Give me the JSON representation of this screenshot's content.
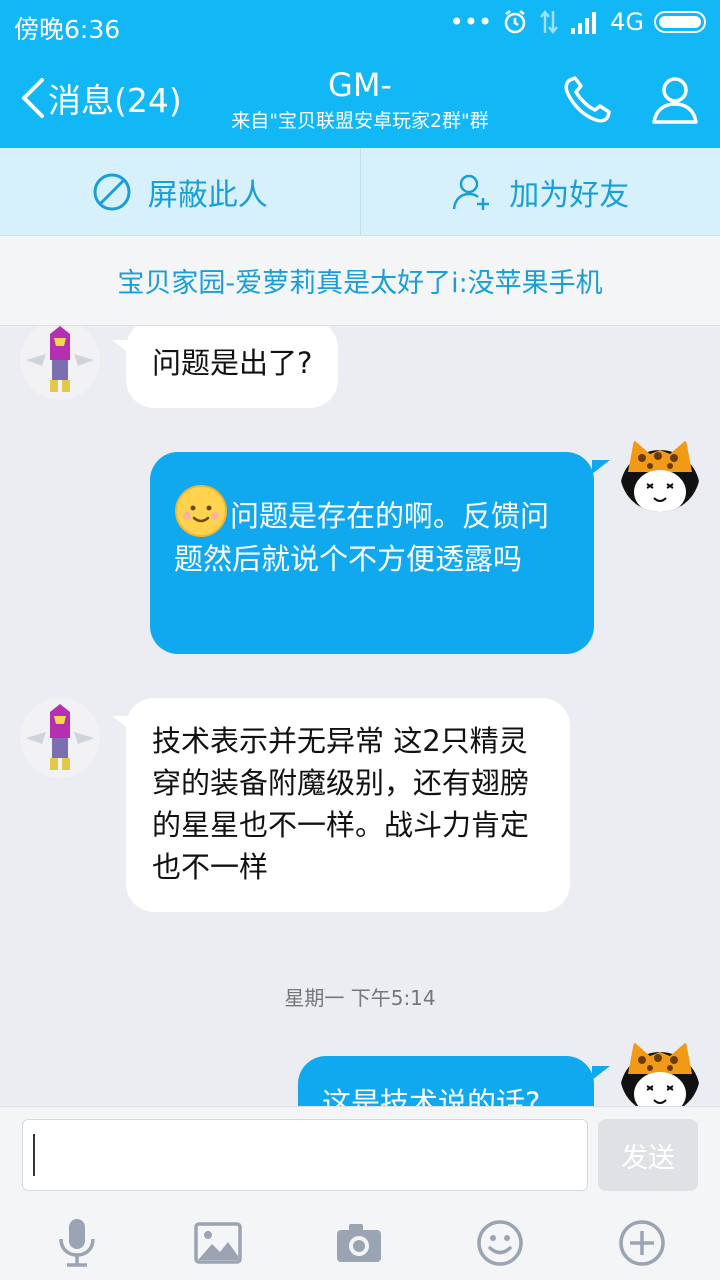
{
  "status_bar": {
    "time": "傍晚6:36",
    "dots": "•••",
    "network": "4G"
  },
  "nav": {
    "back_label": "消息(24)",
    "title": "GM-",
    "subtitle": "来自\"宝贝联盟安卓玩家2群\"群"
  },
  "actions": {
    "block_label": "屏蔽此人",
    "add_friend_label": "加为好友"
  },
  "notice": {
    "text": "宝贝家园-爱萝莉真是太好了i:没苹果手机"
  },
  "messages": [
    {
      "side": "left",
      "text": "问题是出了?"
    },
    {
      "side": "right",
      "text": "问题是存在的啊。反馈问题然后就说个不方便透露吗",
      "has_emoji": true
    },
    {
      "side": "left",
      "text": "技术表示并无异常 这2只精灵 穿的装备附魔级别，还有翅膀的星星也不一样。战斗力肯定也不一样"
    },
    {
      "side": "right",
      "text": "这是技术说的话?"
    }
  ],
  "timestamp": "星期一 下午5:14",
  "input": {
    "value": "",
    "send_label": "发送"
  },
  "colors": {
    "header": "#12b7f5",
    "right_bubble": "#10a8ee",
    "action_bar": "#d6f1fc",
    "accent_text": "#1a9ed6"
  },
  "icons": {
    "back": "chevron-left-icon",
    "call": "phone-icon",
    "profile": "person-icon",
    "block": "block-icon",
    "add_friend": "add-person-icon",
    "toolbar": [
      "microphone-icon",
      "image-icon",
      "camera-icon",
      "emoji-icon",
      "plus-icon"
    ]
  }
}
